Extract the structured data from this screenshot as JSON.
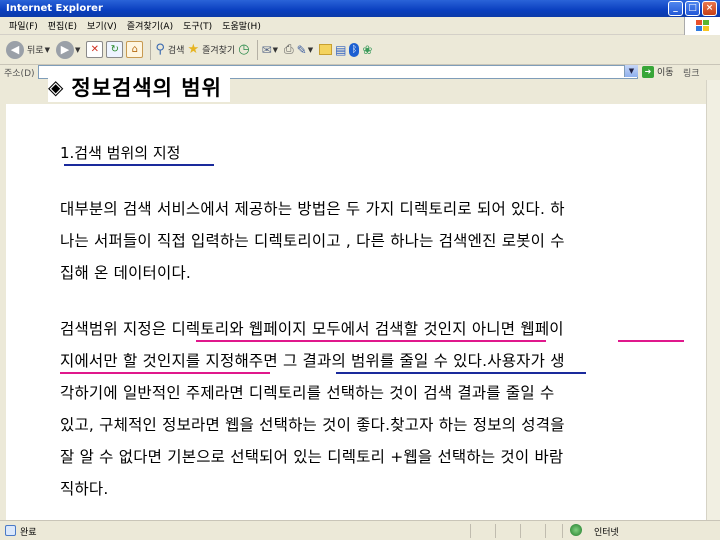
{
  "window": {
    "title": "Internet Explorer",
    "buttons": {
      "minimize": "_",
      "maximize": "□",
      "close": "×"
    }
  },
  "menu": {
    "items": [
      "파일(F)",
      "편집(E)",
      "보기(V)",
      "즐겨찾기(A)",
      "도구(T)",
      "도움말(H)"
    ]
  },
  "toolbar": {
    "back_label": "뒤로",
    "search_label": "검색",
    "favorites_label": "즐겨찾기",
    "icons": [
      "back-icon",
      "forward-icon",
      "stop-icon",
      "refresh-icon",
      "home-icon",
      "search-icon",
      "favorites-icon",
      "history-icon",
      "mail-icon",
      "print-icon",
      "edit-icon",
      "folder-icon",
      "bluetooth-icon",
      "messenger-icon"
    ]
  },
  "address": {
    "label": "주소(D)",
    "value": "",
    "go_label": "이동",
    "links_label": "링크"
  },
  "slide": {
    "title_icon": "◈",
    "title": "정보검색의 범위",
    "heading": "1.검색 범위의 지정",
    "paragraph1": [
      "대부분의 검색 서비스에서 제공하는 방법은 두 가지 디렉토리로 되어 있다. 하",
      "나는 서퍼들이 직접 입력하는 디렉토리이고 , 다른 하나는 검색엔진 로봇이 수",
      "집해 온 데이터이다."
    ],
    "paragraph2": [
      "검색범위 지정은 디렉토리와 웹페이지 모두에서 검색할 것인지 아니면 웹페이",
      "지에서만 할 것인지를 지정해주면 그 결과의 범위를 줄일 수 있다.사용자가 생",
      "각하기에 일반적인 주제라면 디렉토리를 선택하는 것이 검색 결과를 줄일 수",
      "있고, 구체적인 정보라면 웹을 선택하는 것이 좋다.찾고자 하는 정보의 성격을",
      "잘 알 수 없다면 기본으로 선택되어 있는 디렉토리 +웹을 선택하는 것이 바람",
      "직하다."
    ]
  },
  "status": {
    "text": "완료",
    "zone": "인터넷"
  },
  "colors": {
    "title_bar": "#0a3fbf",
    "chrome": "#ece9d8",
    "underline_navy": "#1a2a9c",
    "underline_pink": "#e0188c"
  }
}
